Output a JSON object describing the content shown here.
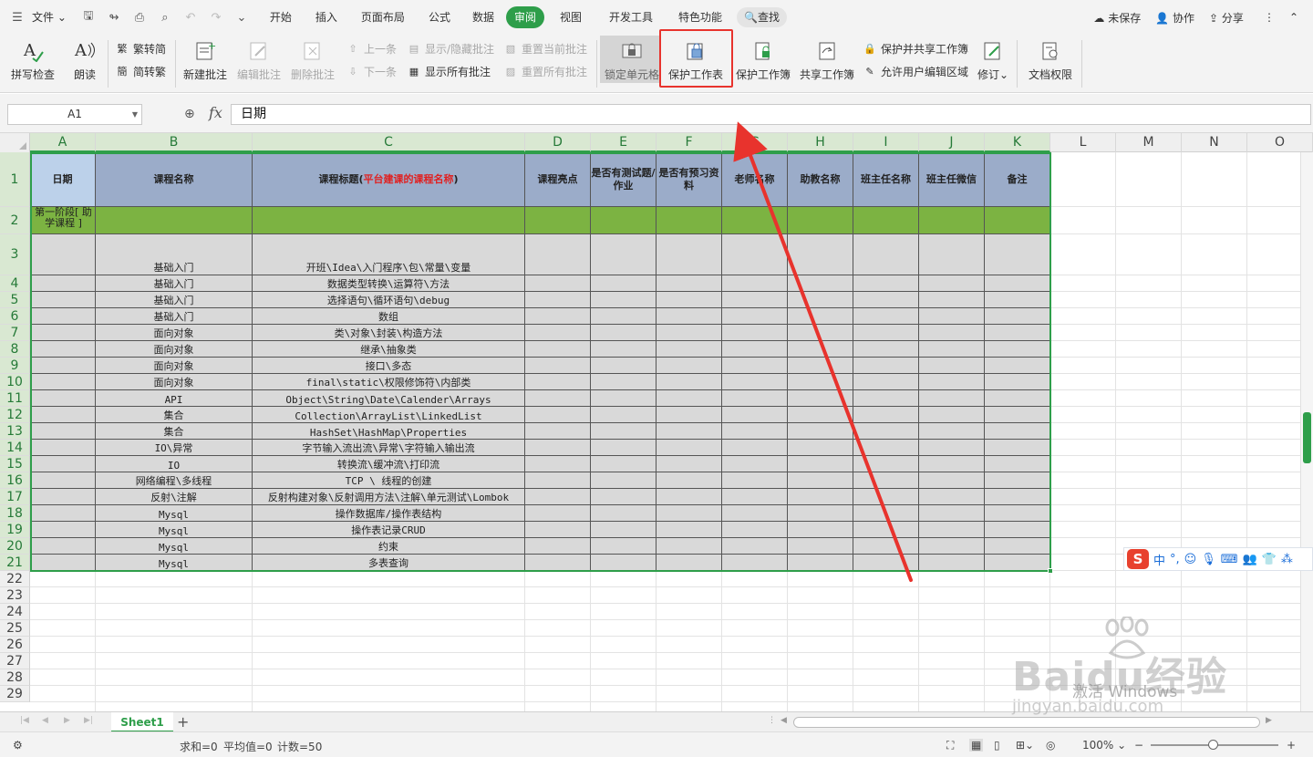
{
  "menubar": {
    "file": "文件",
    "tabs": [
      "开始",
      "插入",
      "页面布局",
      "公式",
      "数据",
      "审阅",
      "视图",
      "开发工具",
      "特色功能"
    ],
    "search": "查找",
    "right": {
      "unsaved": "未保存",
      "collab": "协作",
      "share": "分享"
    }
  },
  "ribbon": {
    "spell": "拼写检查",
    "read": "朗读",
    "trad": "繁转简",
    "simp": "简转繁",
    "new_comment": "新建批注",
    "edit_comment": "编辑批注",
    "del_comment": "删除批注",
    "prev": "上一条",
    "next": "下一条",
    "show_hide": "显示/隐藏批注",
    "show_all": "显示所有批注",
    "reset_current": "重置当前批注",
    "reset_all": "重置所有批注",
    "lock_cell": "锁定单元格",
    "protect_sheet": "保护工作表",
    "protect_book": "保护工作簿",
    "share_book": "共享工作簿",
    "protect_share": "保护并共享工作簿",
    "allow_edit": "允许用户编辑区域",
    "revise": "修订",
    "doc_rights": "文档权限"
  },
  "formula": {
    "name_box": "A1",
    "content": "日期"
  },
  "columns": [
    "A",
    "B",
    "C",
    "D",
    "E",
    "F",
    "G",
    "H",
    "I",
    "J",
    "K",
    "L",
    "M",
    "N",
    "O"
  ],
  "rows": [
    "1",
    "2",
    "3",
    "4",
    "5",
    "6",
    "7",
    "8",
    "9",
    "10",
    "11",
    "12",
    "13",
    "14",
    "15",
    "16",
    "17",
    "18",
    "19",
    "20",
    "21",
    "22",
    "23",
    "24",
    "25",
    "26",
    "27",
    "28",
    "29"
  ],
  "table": {
    "headers": {
      "date": "日期",
      "course": "课程名称",
      "title_a": "课程标题(",
      "title_red": "平台建课的课程名称",
      "title_b": ")",
      "highlight": "课程亮点",
      "test": "是否有测试题/作业",
      "prep": "是否有预习资料",
      "teacher": "老师名称",
      "assistant": "助教名称",
      "head": "班主任名称",
      "wechat": "班主任微信",
      "note": "备注"
    },
    "stage": "第一阶段[ 助学课程 ]",
    "rows": [
      {
        "course": "基础入门",
        "title": "开班\\Idea\\入门程序\\包\\常量\\变量"
      },
      {
        "course": "基础入门",
        "title": "数据类型转换\\运算符\\方法"
      },
      {
        "course": "基础入门",
        "title": "选择语句\\循环语句\\debug"
      },
      {
        "course": "基础入门",
        "title": "数组"
      },
      {
        "course": "面向对象",
        "title": "类\\对象\\封装\\构造方法"
      },
      {
        "course": "面向对象",
        "title": "继承\\抽象类"
      },
      {
        "course": "面向对象",
        "title": "接口\\多态"
      },
      {
        "course": "面向对象",
        "title": "final\\static\\权限修饰符\\内部类"
      },
      {
        "course": "API",
        "title": "Object\\String\\Date\\Calender\\Arrays"
      },
      {
        "course": "集合",
        "title": "Collection\\ArrayList\\LinkedList"
      },
      {
        "course": "集合",
        "title": "HashSet\\HashMap\\Properties"
      },
      {
        "course": "IO\\异常",
        "title": "字节输入流出流\\异常\\字符输入输出流"
      },
      {
        "course": "IO",
        "title": "转换流\\缓冲流\\打印流"
      },
      {
        "course": "网络编程\\多线程",
        "title": "TCP \\ 线程的创建"
      },
      {
        "course": "反射\\注解",
        "title": "反射构建对象\\反射调用方法\\注解\\单元测试\\Lombok"
      },
      {
        "course": "Mysql",
        "title": "操作数据库/操作表结构"
      },
      {
        "course": "Mysql",
        "title": "操作表记录CRUD"
      },
      {
        "course": "Mysql",
        "title": "约束"
      },
      {
        "course": "Mysql",
        "title": "多表查询"
      }
    ]
  },
  "sheet_tab": "Sheet1",
  "status": {
    "sum": "求和=0",
    "avg": "平均值=0",
    "count": "计数=50",
    "zoom": "100%"
  },
  "ime": {
    "lang": "中"
  },
  "watermark": {
    "brand": "Baidu经验",
    "activate": "激活 Windows",
    "url": "jingyan.baidu.com"
  },
  "colors": {
    "accent": "#2e9e4a",
    "header_fill": "#9bacc9",
    "stage_fill": "#7cb342",
    "body_fill": "#d9d9d9",
    "annotation": "#e8332d"
  }
}
